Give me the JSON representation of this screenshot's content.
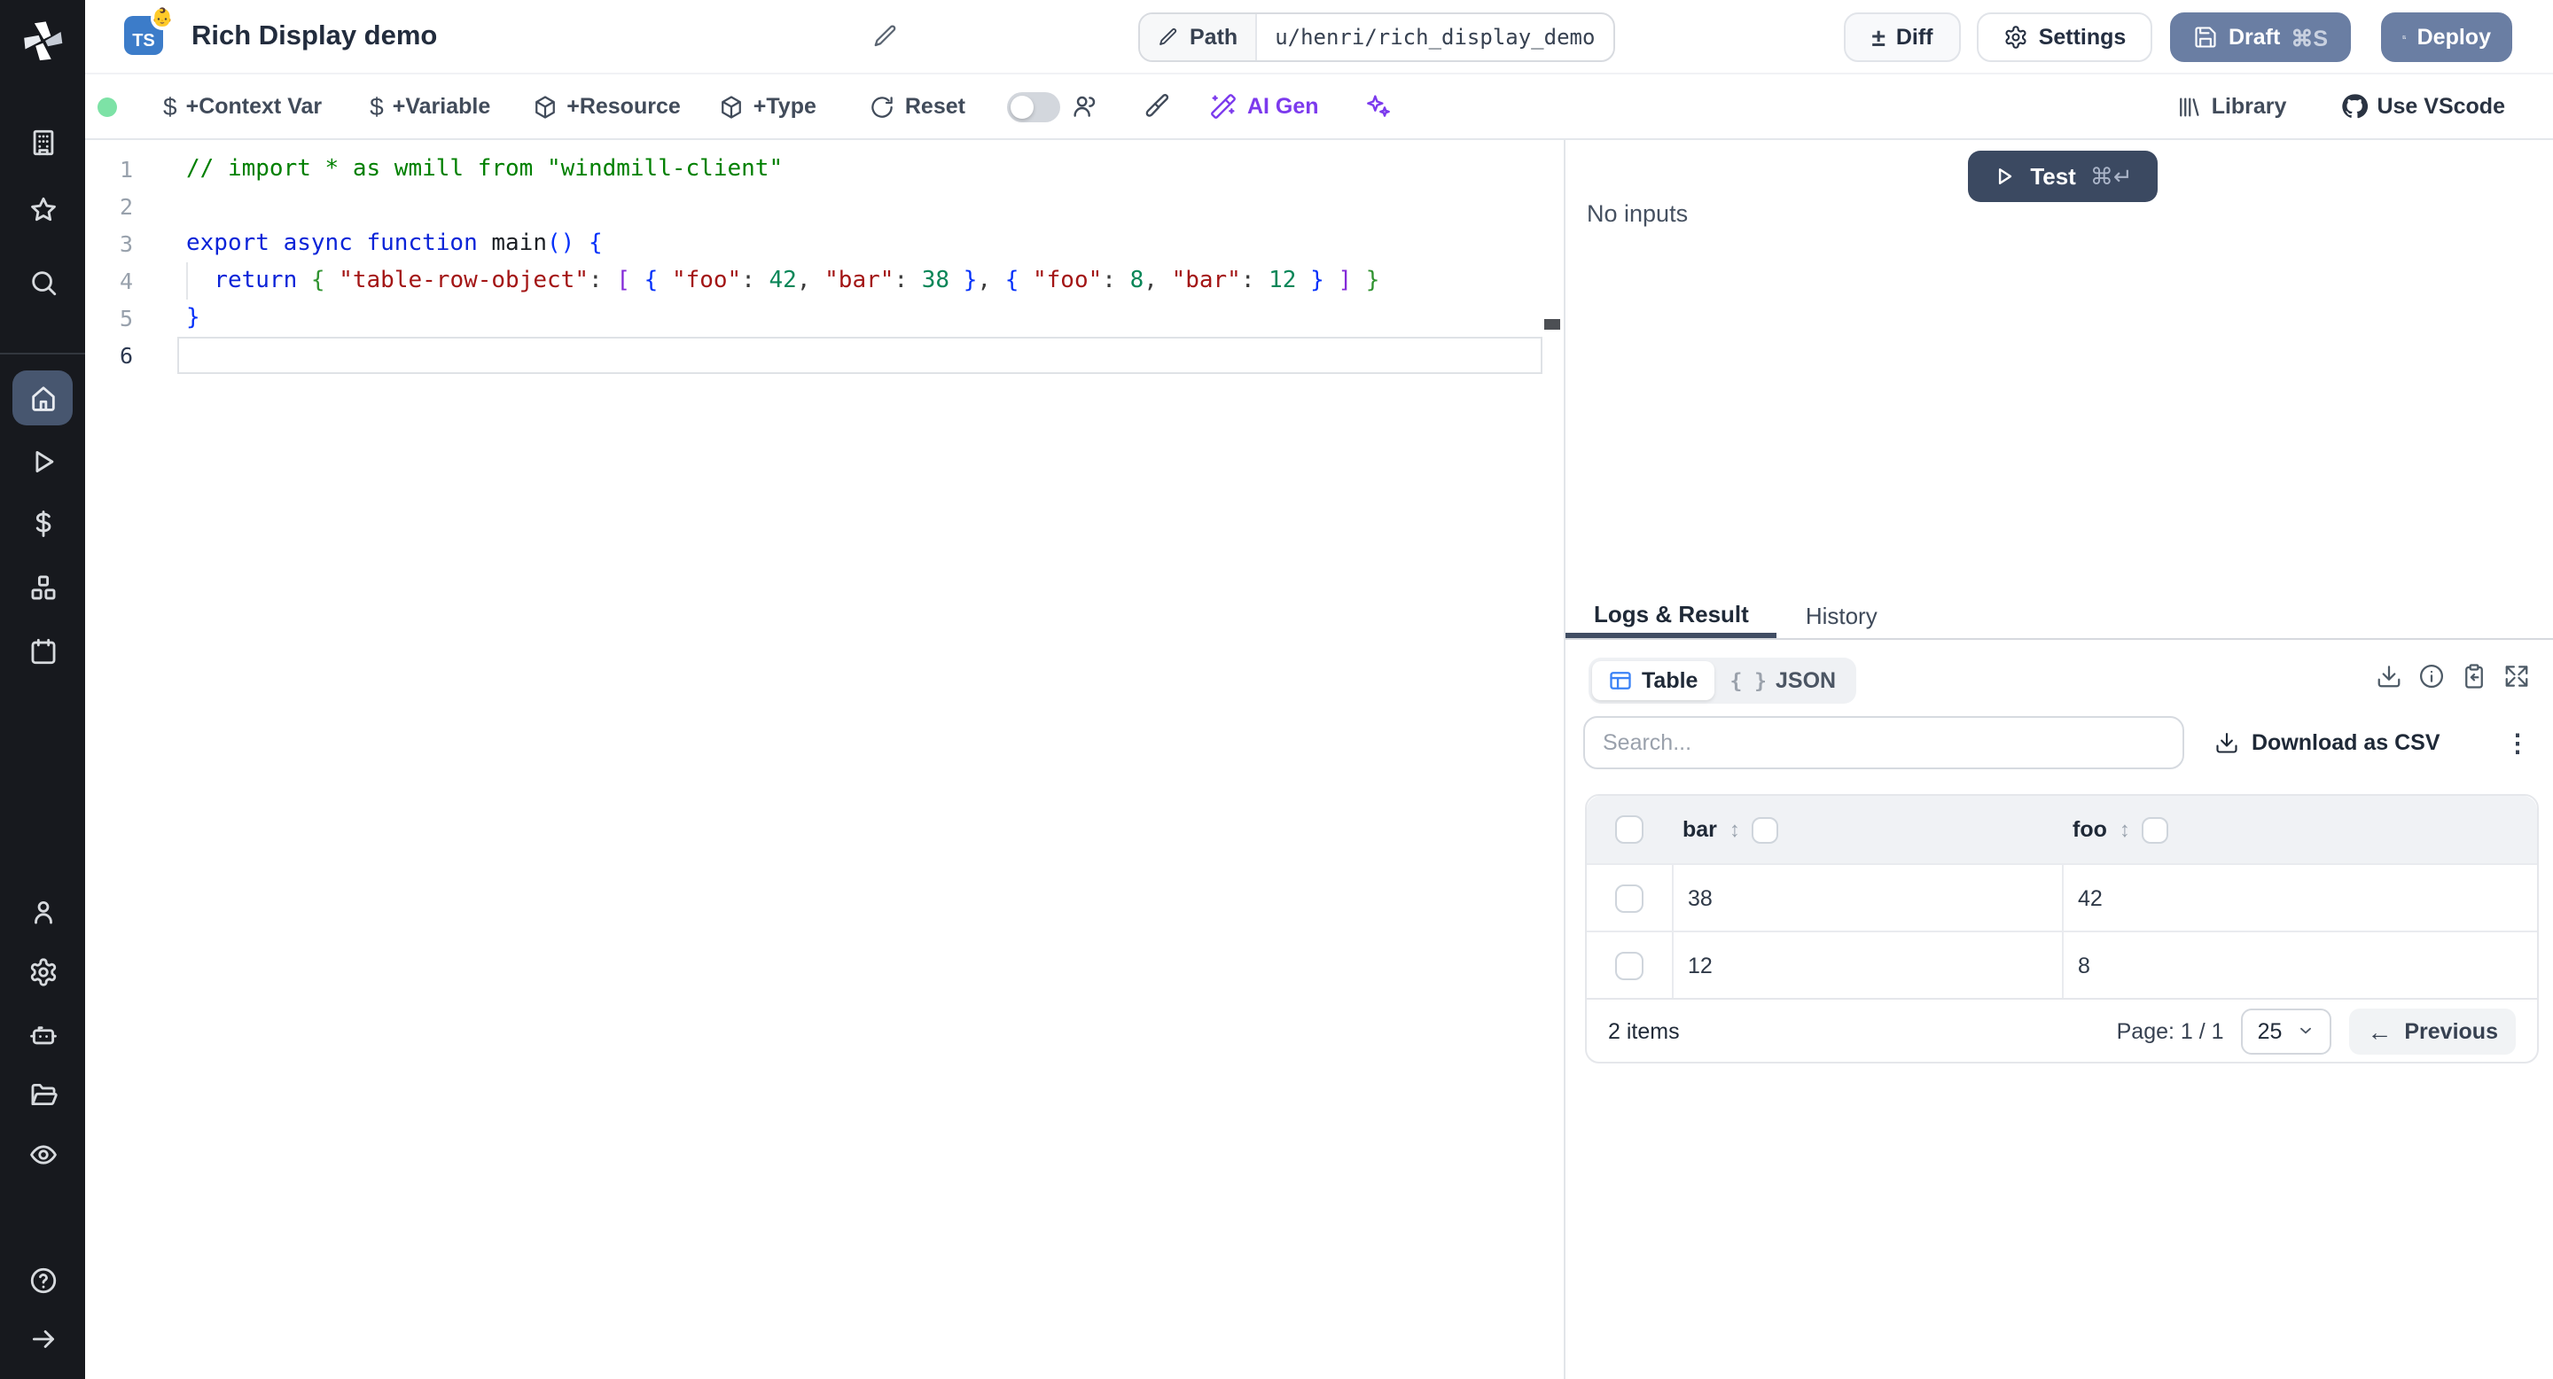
{
  "header": {
    "title": "Rich Display demo",
    "ts": "TS",
    "ts_emoji": "👶",
    "path_label": "Path",
    "path_value": "u/henri/rich_display_demo",
    "diff": "Diff",
    "settings": "Settings",
    "draft": "Draft",
    "draft_shortcut": "⌘S",
    "deploy": "Deploy"
  },
  "toolbar": {
    "context_var": "+Context Var",
    "variable": "+Variable",
    "resource": "+Resource",
    "type": "+Type",
    "reset": "Reset",
    "ai_gen": "AI Gen",
    "library": "Library",
    "use_vscode": "Use VScode",
    "status_color": "#7de2a6",
    "accent_violet": "#7c3aed"
  },
  "editor": {
    "line_numbers": [
      1,
      2,
      3,
      4,
      5,
      6
    ],
    "active_line": 6,
    "lines": [
      [
        [
          "cm",
          "// import * as wmill from \"windmill-client\""
        ]
      ],
      [],
      [
        [
          "kw",
          "export async function "
        ],
        [
          "fn",
          "main"
        ],
        [
          "b1",
          "()"
        ],
        [
          "pl",
          " "
        ],
        [
          "b1",
          "{"
        ]
      ],
      [
        [
          "pl",
          "  "
        ],
        [
          "kw",
          "return"
        ],
        [
          "pl",
          " "
        ],
        [
          "b2",
          "{"
        ],
        [
          "pl",
          " "
        ],
        [
          "str",
          "\"table-row-object\""
        ],
        [
          "pl",
          ": "
        ],
        [
          "b3",
          "["
        ],
        [
          "pl",
          " "
        ],
        [
          "b1",
          "{"
        ],
        [
          "pl",
          " "
        ],
        [
          "str",
          "\"foo\""
        ],
        [
          "pl",
          ": "
        ],
        [
          "num",
          "42"
        ],
        [
          "pl",
          ", "
        ],
        [
          "str",
          "\"bar\""
        ],
        [
          "pl",
          ": "
        ],
        [
          "num",
          "38"
        ],
        [
          "pl",
          " "
        ],
        [
          "b1",
          "}"
        ],
        [
          "pl",
          ", "
        ],
        [
          "b1",
          "{"
        ],
        [
          "pl",
          " "
        ],
        [
          "str",
          "\"foo\""
        ],
        [
          "pl",
          ": "
        ],
        [
          "num",
          "8"
        ],
        [
          "pl",
          ", "
        ],
        [
          "str",
          "\"bar\""
        ],
        [
          "pl",
          ": "
        ],
        [
          "num",
          "12"
        ],
        [
          "pl",
          " "
        ],
        [
          "b1",
          "}"
        ],
        [
          "pl",
          " "
        ],
        [
          "b3",
          "]"
        ],
        [
          "pl",
          " "
        ],
        [
          "b2",
          "}"
        ]
      ],
      [
        [
          "b1",
          "}"
        ]
      ],
      []
    ]
  },
  "run": {
    "test": "Test",
    "cmd": "⌘",
    "enter": "↵",
    "no_inputs": "No inputs"
  },
  "result": {
    "tab_logs": "Logs & Result",
    "tab_history": "History",
    "active_tab": "Logs & Result",
    "table_label": "Table",
    "json_label": "JSON",
    "braces": "{ }",
    "search_placeholder": "Search...",
    "download_csv": "Download as CSV",
    "table": {
      "columns": [
        "bar",
        "foo"
      ],
      "rows": [
        [
          "38",
          "42"
        ],
        [
          "12",
          "8"
        ]
      ],
      "items_label": "2 items",
      "page_label": "Page: 1 / 1",
      "page_size": "25",
      "previous": "Previous"
    }
  },
  "icons": {
    "plusminus": "±",
    "sort": "↕",
    "kebab": "⋮",
    "arrow_left": "←",
    "dollar": "$"
  }
}
